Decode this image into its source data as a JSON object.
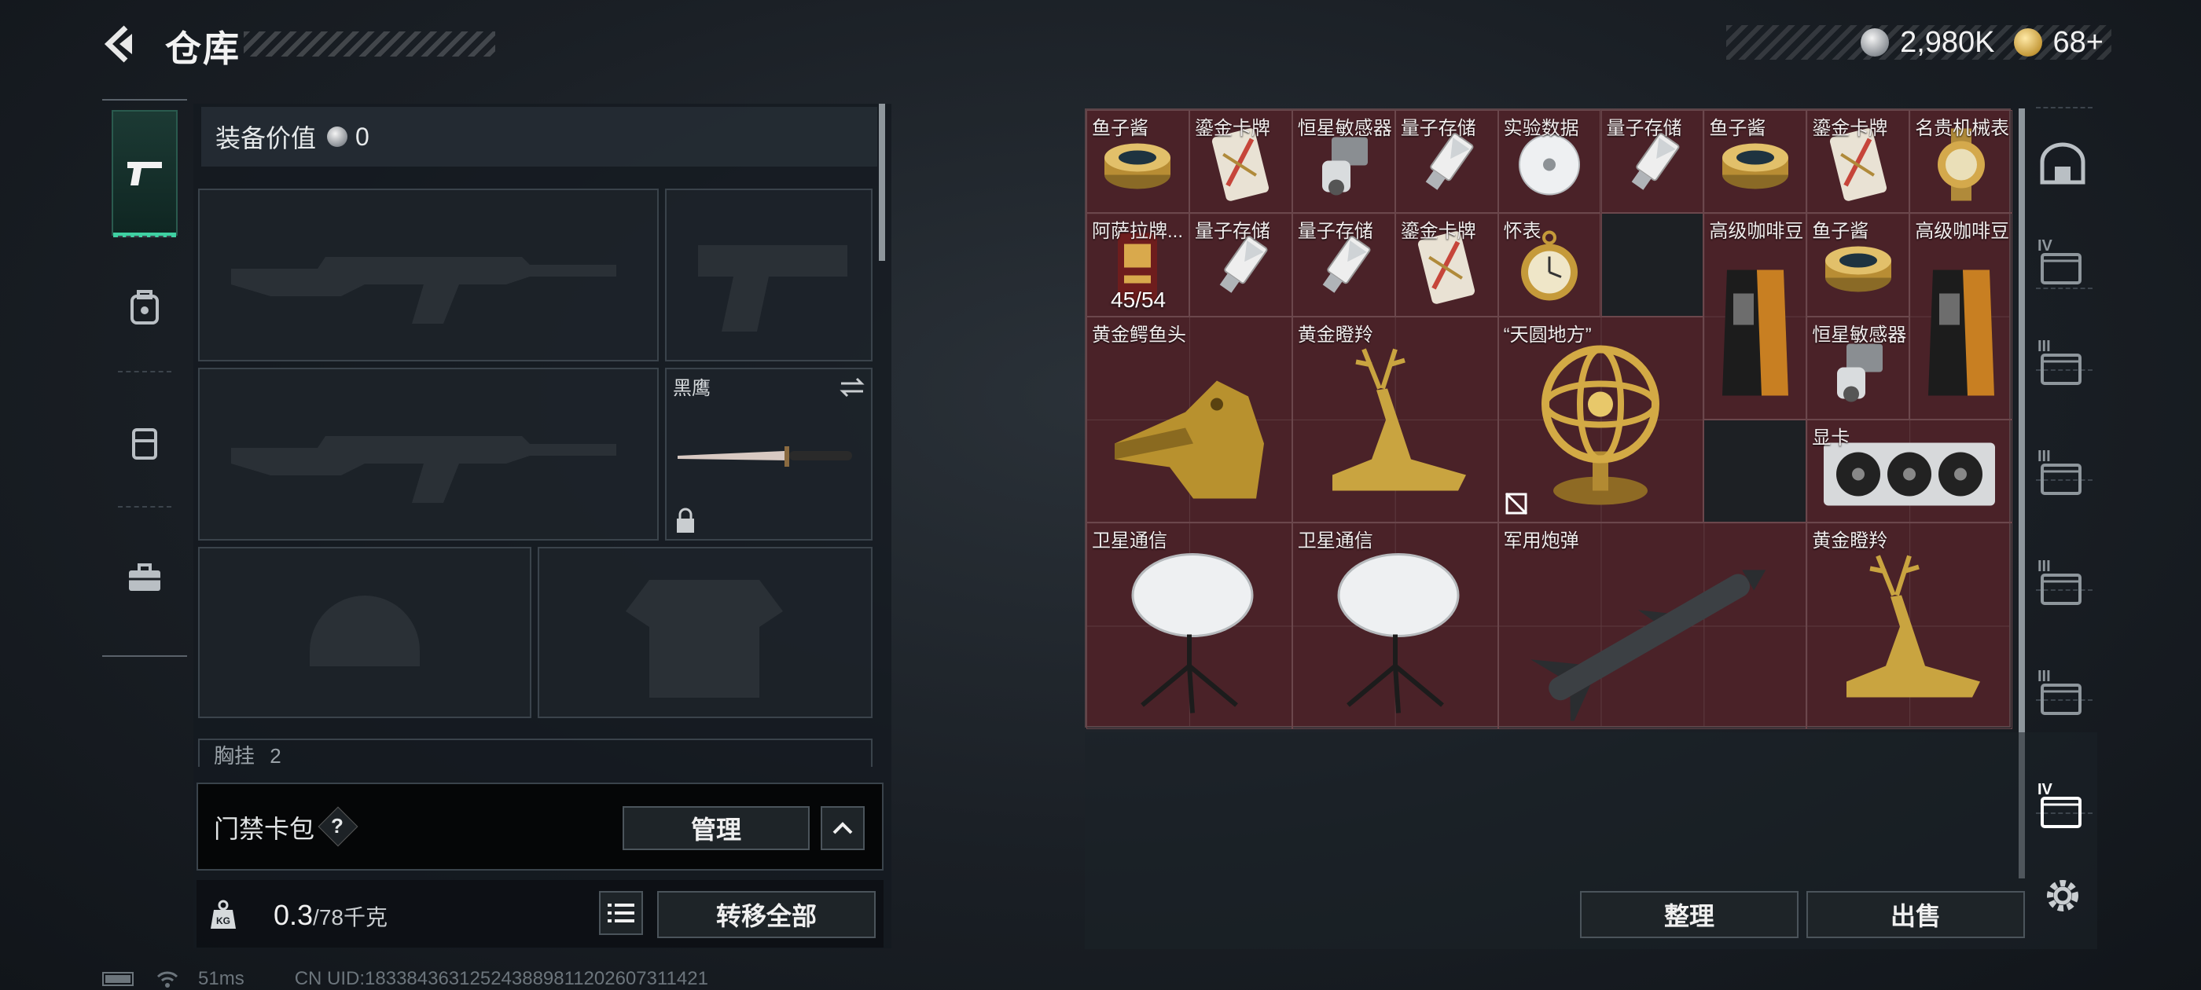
{
  "header": {
    "title": "仓库"
  },
  "currency": {
    "silver": "2,980K",
    "gold": "68+"
  },
  "equipment": {
    "value_label": "装备价值",
    "value": "0",
    "knife_label": "黑鹰",
    "chest_label": "胸挂",
    "chest_count": "2"
  },
  "keycard": {
    "label": "门禁卡包",
    "help": "?",
    "manage": "管理"
  },
  "weight": {
    "current": "0.3",
    "max": "/78千克",
    "kg_label": "KG"
  },
  "actions": {
    "transfer_all": "转移全部",
    "organize": "整理",
    "sell": "出售"
  },
  "footer": {
    "ping": "51ms",
    "uid": "CN UID:183384363125243889811202607311421"
  },
  "items": [
    {
      "name": "鱼子酱"
    },
    {
      "name": "鎏金卡牌"
    },
    {
      "name": "恒星敏感器"
    },
    {
      "name": "量子存储"
    },
    {
      "name": "实验数据"
    },
    {
      "name": "量子存储"
    },
    {
      "name": "鱼子酱"
    },
    {
      "name": "鎏金卡牌"
    },
    {
      "name": "名贵机械表"
    },
    {
      "name": "阿萨拉牌...",
      "count": "45/54"
    },
    {
      "name": "量子存储"
    },
    {
      "name": "量子存储"
    },
    {
      "name": "鎏金卡牌"
    },
    {
      "name": "怀表"
    },
    {
      "name": "高级咖啡豆"
    },
    {
      "name": "鱼子酱"
    },
    {
      "name": "高级咖啡豆"
    },
    {
      "name": "恒星敏感器"
    },
    {
      "name": "黄金鳄鱼头"
    },
    {
      "name": "黄金瞪羚"
    },
    {
      "name": "“天圆地方”"
    },
    {
      "name": "显卡"
    },
    {
      "name": "卫星通信"
    },
    {
      "name": "卫星通信"
    },
    {
      "name": "军用炮弹"
    },
    {
      "name": "黄金瞪羚"
    }
  ],
  "rail_labels": [
    "IV",
    "III",
    "III",
    "III",
    "III",
    "IV"
  ],
  "colors": {
    "accent": "#3fd0a2",
    "grid_bg": "#4a2228",
    "gold": "#c59a3a"
  }
}
